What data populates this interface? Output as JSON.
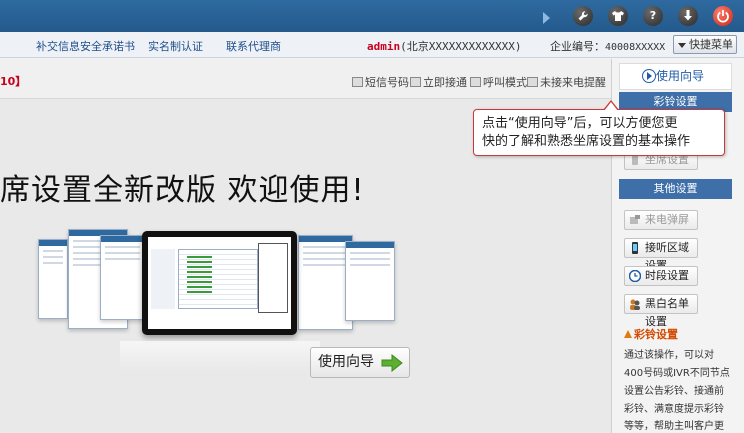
{
  "topbar": {
    "icons": [
      "wrench-icon",
      "shirt-icon",
      "help-icon",
      "download-icon",
      "power-icon"
    ],
    "help_glyph": "?"
  },
  "nav": {
    "links": [
      "补交信息安全承诺书",
      "实名制认证",
      "联系代理商"
    ],
    "admin_name": "admin",
    "admin_region": "(北京XXXXXXXXXXXXX)",
    "company_label": "企业编号：",
    "company_code": "40008XXXXX",
    "quick_menu": "快捷菜单"
  },
  "main": {
    "bracket_text": "10】",
    "toolbar": [
      "短信号码",
      "立即接通",
      "呼叫模式",
      "未接来电提醒"
    ],
    "headline": "席设置全新改版  欢迎使用!",
    "guide_button": "使用向导"
  },
  "sidebar": {
    "usage_guide": "使用向导",
    "section_ringtone": "彩铃设置",
    "partial_item": "坐席设置",
    "section_other": "其他设置",
    "buttons": [
      {
        "label": "来电弹屏",
        "disabled": true
      },
      {
        "label": "接听区域设置",
        "disabled": false
      },
      {
        "label": "时段设置",
        "disabled": false
      },
      {
        "label": "黑白名单设置",
        "disabled": false
      }
    ],
    "color_ring_title": "彩铃设置",
    "color_ring_lines": [
      "通过该操作，可以对",
      "400号码或IVR不同节点",
      "设置公告彩铃、接通前",
      "彩铃、满意度提示彩铃",
      "等等，帮助主叫客户更"
    ]
  },
  "tooltip": {
    "line1": "点击“使用向导”后，可以方便您更",
    "line2": "快的了解和熟悉坐席设置的基本操作"
  },
  "colors": {
    "topbar": "#2e6aa0",
    "section_header": "#3e6fa8",
    "accent_red": "#c8001e",
    "tooltip_border": "#c83a3a",
    "link_blue": "#1f4e8c"
  }
}
